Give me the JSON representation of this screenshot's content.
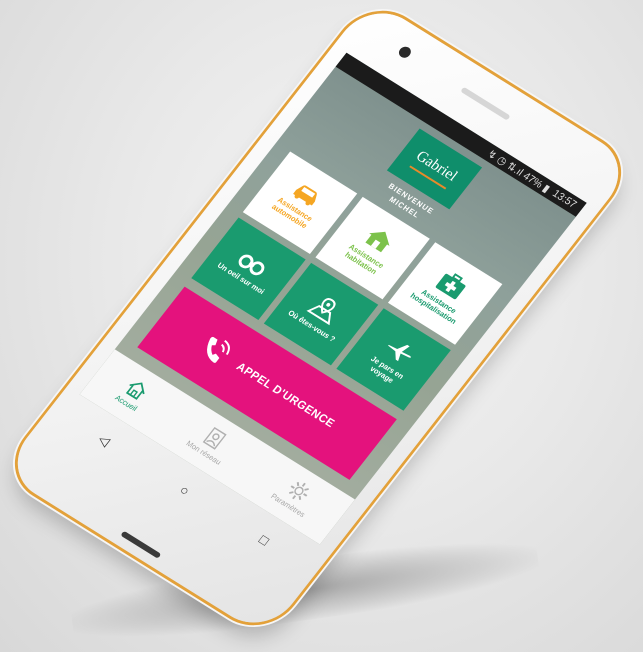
{
  "statusbar": {
    "time": "13:57",
    "icons": "↯ ◷ ⇅.ıl 47% ▮"
  },
  "brand": {
    "name": "Gabriel"
  },
  "welcome": {
    "line1": "BIENVENUE",
    "line2": "MICHEL"
  },
  "tiles": [
    {
      "label_1": "Assistance",
      "label_2": "automobile",
      "icon": "car-icon",
      "color": "#f5a623"
    },
    {
      "label_1": "Assistance",
      "label_2": "habitation",
      "icon": "house-icon",
      "color": "#7cc24b"
    },
    {
      "label_1": "Assistance",
      "label_2": "hospitalisation",
      "icon": "medical-kit-icon",
      "color": "#1a9b6f"
    },
    {
      "label_1": "Un oeil sur moi",
      "label_2": "",
      "icon": "binoculars-icon",
      "color": "#1a9b6f"
    },
    {
      "label_1": "Où êtes-vous ?",
      "label_2": "",
      "icon": "map-pin-icon",
      "color": "#1a9b6f"
    },
    {
      "label_1": "Je pars en",
      "label_2": "voyage",
      "icon": "airplane-icon",
      "color": "#1a9b6f"
    }
  ],
  "emergency": {
    "label": "APPEL D'URGENCE",
    "icon": "phone-icon",
    "color": "#e4127d"
  },
  "tabs": [
    {
      "label": "Accueil",
      "icon": "home-icon",
      "active": true
    },
    {
      "label": "Mon réseau",
      "icon": "network-icon",
      "active": false
    },
    {
      "label": "Paramètres",
      "icon": "gear-icon",
      "active": false
    }
  ],
  "system_nav": {
    "back": "◁",
    "home": "○",
    "recent": "□"
  }
}
